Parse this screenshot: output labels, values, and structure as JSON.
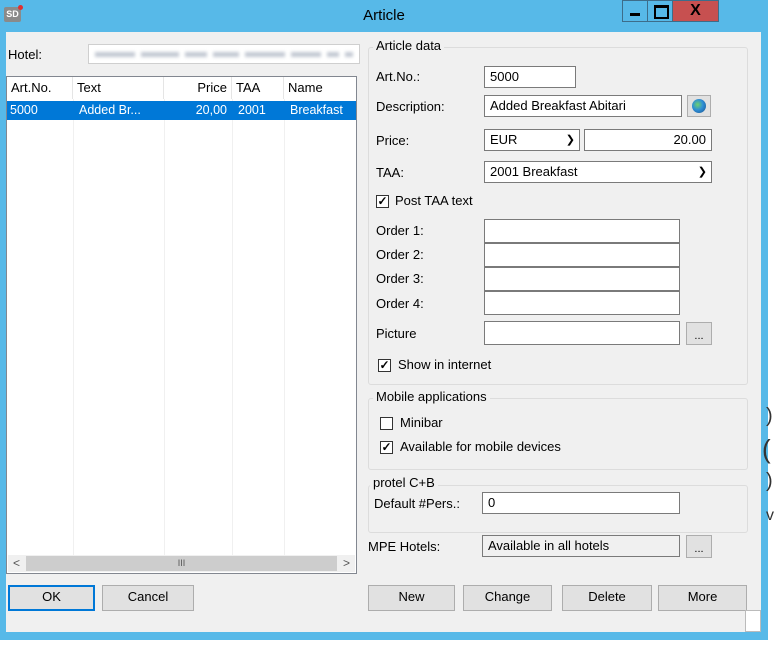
{
  "window": {
    "title": "Article",
    "icon_text": "SD",
    "close_glyph": "X"
  },
  "left": {
    "hotel_label": "Hotel:",
    "columns": [
      "Art.No.",
      "Text",
      "Price",
      "TAA",
      "Name"
    ],
    "rows": [
      {
        "art_no": "5000",
        "text": "Added Br...",
        "price": "20,00",
        "taa": "2001",
        "name": "Breakfast"
      }
    ],
    "scroll_left": "<",
    "scroll_mid": "III",
    "scroll_right": ">"
  },
  "article_data": {
    "group_title": "Article data",
    "art_no_label": "Art.No.:",
    "art_no_value": "5000",
    "description_label": "Description:",
    "description_value": "Added Breakfast Abitari",
    "price_label": "Price:",
    "currency_value": "EUR",
    "price_value": "20.00",
    "taa_label": "TAA:",
    "taa_value": "2001 Breakfast",
    "post_taa_label": "Post TAA text",
    "post_taa_checked": true,
    "order1_label": "Order 1:",
    "order2_label": "Order 2:",
    "order3_label": "Order 3:",
    "order4_label": "Order 4:",
    "picture_label": "Picture",
    "browse_label": "...",
    "show_internet_label": "Show in internet",
    "show_internet_checked": true
  },
  "mobile": {
    "group_title": "Mobile applications",
    "minibar_label": "Minibar",
    "minibar_checked": false,
    "available_label": "Available for mobile devices",
    "available_checked": true
  },
  "protel": {
    "group_title": "protel C+B",
    "default_pers_label": "Default #Pers.:",
    "default_pers_value": "0"
  },
  "mpe": {
    "label": "MPE Hotels:",
    "value": "Available in all hotels",
    "browse_label": "..."
  },
  "buttons": {
    "ok": "OK",
    "cancel": "Cancel",
    "new": "New",
    "change": "Change",
    "delete": "Delete",
    "more": "More"
  },
  "background_fragments": [
    ")",
    "(",
    ")",
    "v"
  ],
  "colors": {
    "titlebar": "#57b9e8",
    "close": "#c75050",
    "selection": "#0078d7",
    "dialog": "#f0f0f0"
  }
}
